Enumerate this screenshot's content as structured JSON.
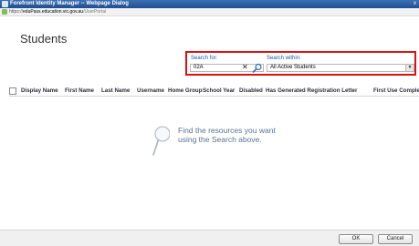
{
  "window": {
    "title": "Forefront Identity Manager -- Webpage Dialog",
    "close_glyph": "x"
  },
  "address": {
    "scheme": "https://",
    "domain": "eduPass.education.vic.gov.au",
    "path": "/UserPortal"
  },
  "page": {
    "title": "Students"
  },
  "search": {
    "for_label": "Search for:",
    "for_value": "02A",
    "clear_glyph": "✕",
    "within_label": "Search within:",
    "within_value": "All Active Students",
    "highlight_color": "#e01010"
  },
  "table": {
    "columns": [
      "Display Name",
      "First Name",
      "Last Name",
      "Username",
      "Home Group",
      "School Year",
      "Disabled",
      "Has Generated Registration Letter",
      "First Use Completed"
    ]
  },
  "empty_state": {
    "line1": "Find the resources you want",
    "line2": "using the Search above.",
    "icon": "magnifier-icon"
  },
  "footer": {
    "ok_label": "OK",
    "cancel_label": "Cancel"
  }
}
